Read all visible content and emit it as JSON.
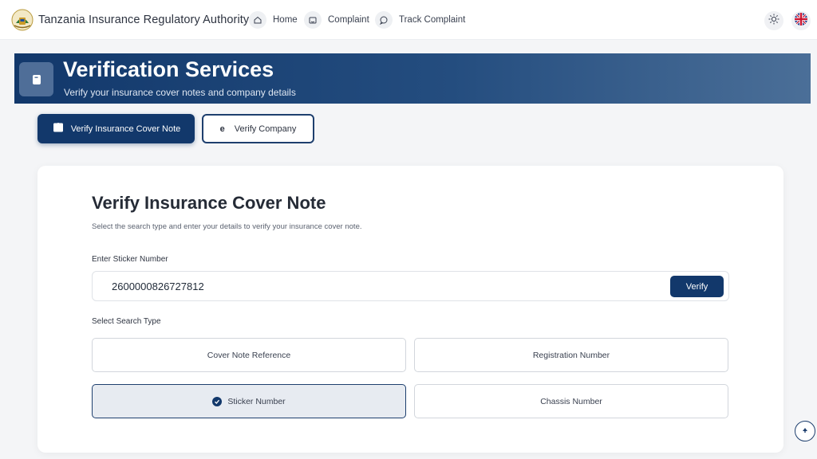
{
  "header": {
    "brand": "Tanzania Insurance Regulatory Authority",
    "nav": [
      {
        "label": "Home",
        "icon": "home-icon"
      },
      {
        "label": "Complaint",
        "icon": "complaint-icon"
      },
      {
        "label": "Track Complaint",
        "icon": "chat-icon"
      }
    ],
    "theme_icon": "sun-icon",
    "language_icon": "uk-flag-icon"
  },
  "hero": {
    "title": "Verification Services",
    "subtitle": "Verify your insurance cover notes and company details"
  },
  "tabs": [
    {
      "label": "Verify Insurance Cover Note",
      "active": true
    },
    {
      "label": "Verify Company",
      "active": false
    }
  ],
  "form": {
    "title": "Verify Insurance Cover Note",
    "subtitle": "Select the search type and enter your details to verify your insurance cover note.",
    "field_label": "Enter Sticker Number",
    "field_value": "2600000826727812",
    "verify_label": "Verify",
    "type_label": "Select Search Type",
    "options": [
      {
        "label": "Cover Note Reference",
        "selected": false
      },
      {
        "label": "Registration Number",
        "selected": false
      },
      {
        "label": "Sticker Number",
        "selected": true
      },
      {
        "label": "Chassis Number",
        "selected": false
      }
    ]
  },
  "colors": {
    "primary": "#12386b",
    "selected_bg": "#e7ebf1"
  }
}
